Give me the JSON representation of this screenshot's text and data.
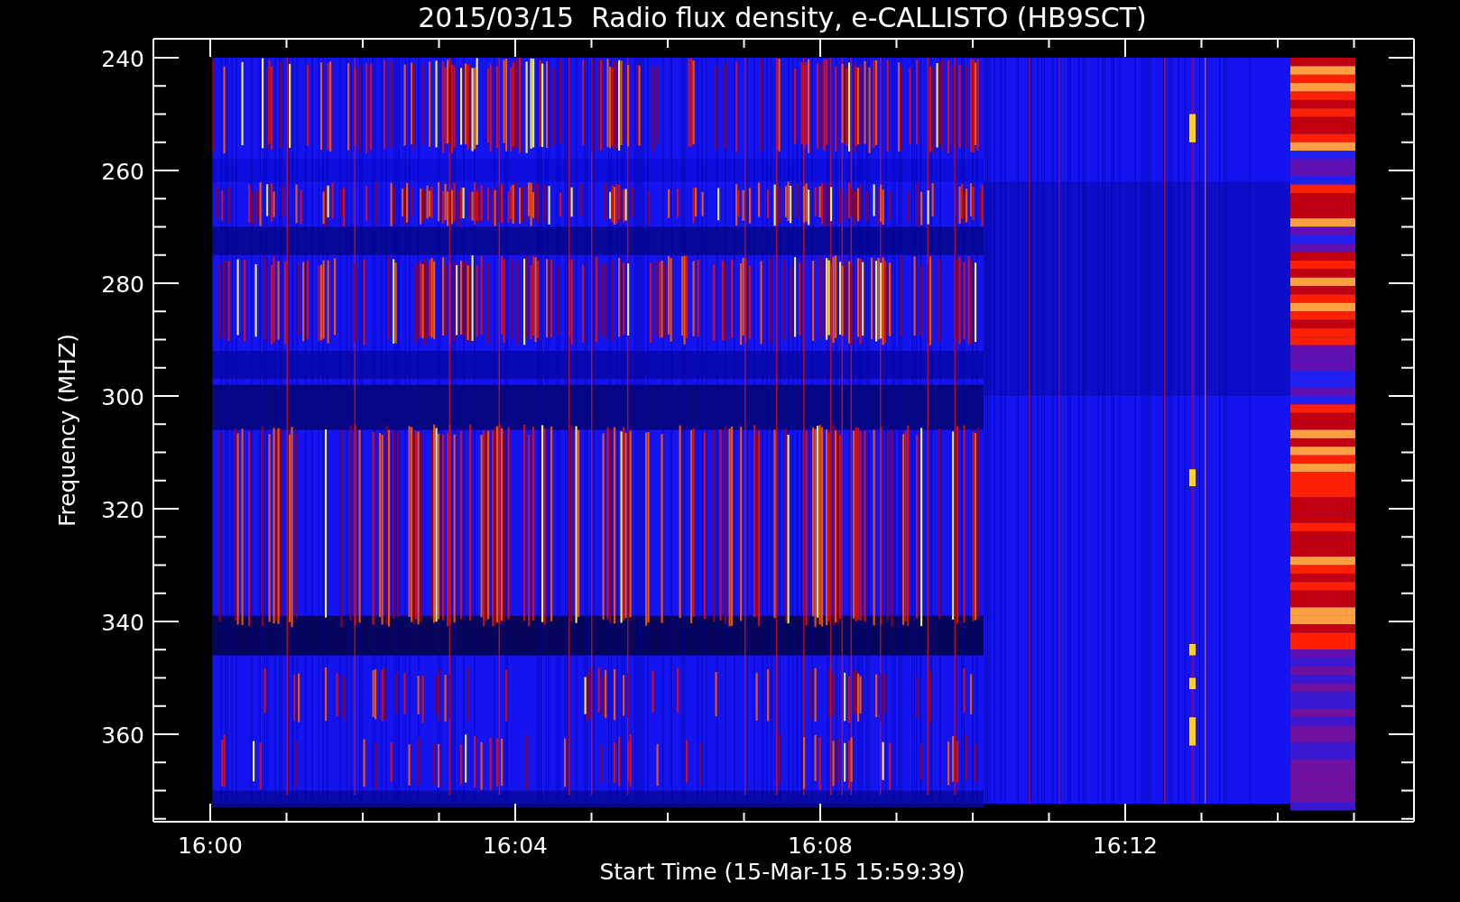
{
  "plot": {
    "title": "2015/03/15  Radio flux density, e-CALLISTO (HB9SCT)",
    "ylabel": "Frequency (MHZ)",
    "xlabel": "Start Time (15-Mar-15 15:59:39)",
    "y_tick_labels": [
      "240",
      "260",
      "280",
      "300",
      "320",
      "340",
      "360"
    ],
    "x_tick_labels": [
      "16:00",
      "16:04",
      "16:08",
      "16:12"
    ]
  }
}
